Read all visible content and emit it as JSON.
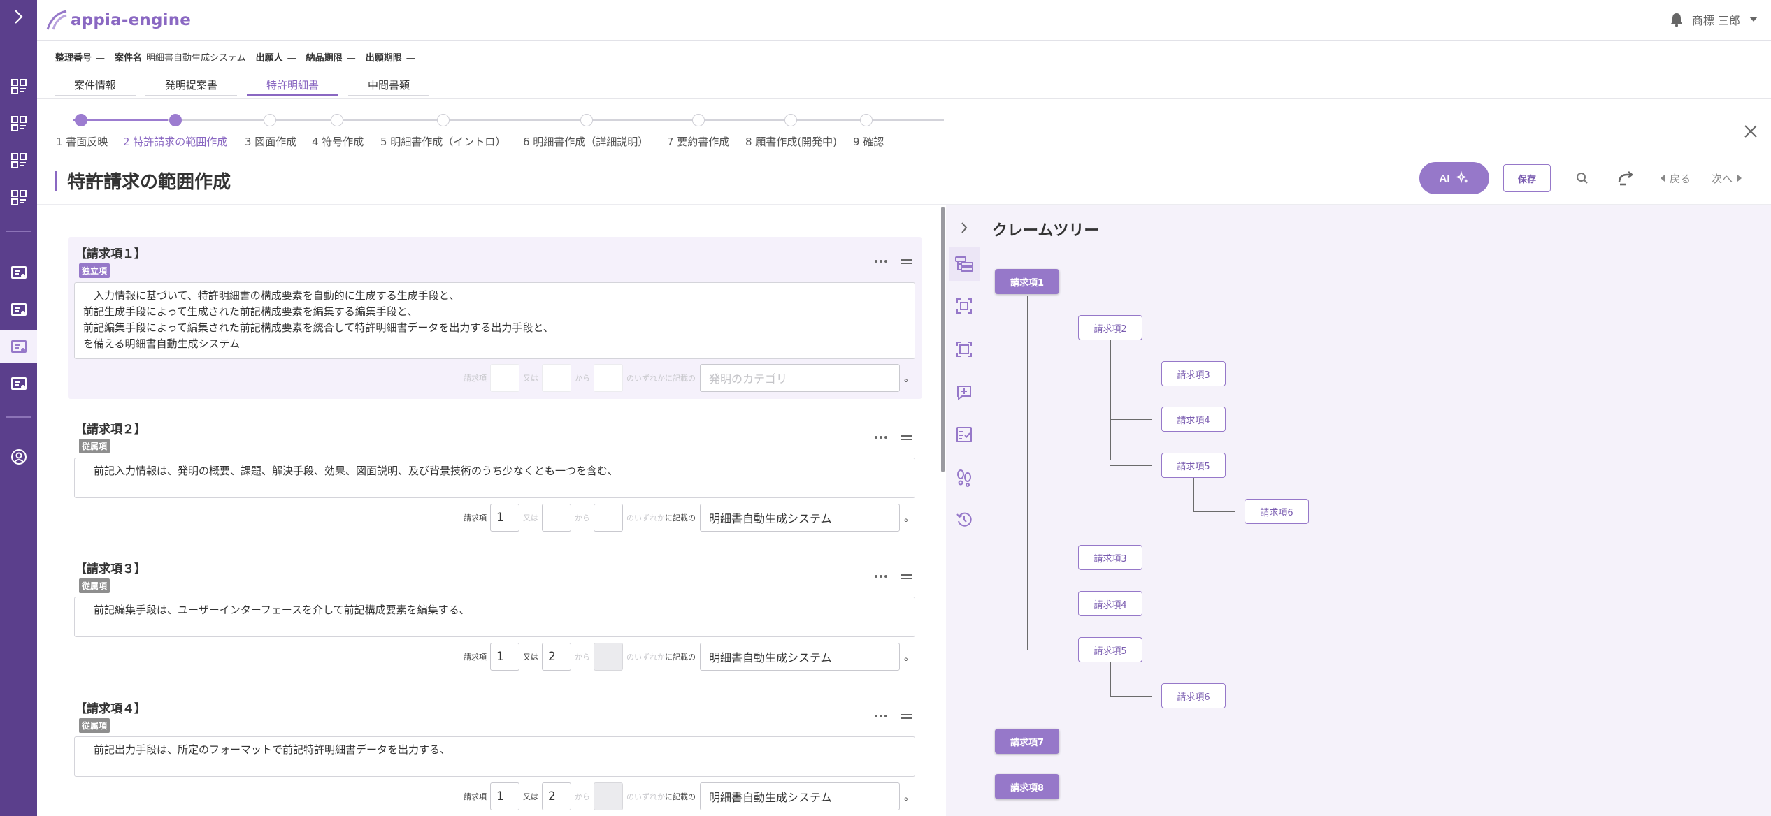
{
  "app": {
    "logo_text": "appia-engine",
    "user_name": "商標 三郎"
  },
  "case_info": [
    {
      "label": "整理番号",
      "value": "—"
    },
    {
      "label": "案件名",
      "value": "明細書自動生成システム"
    },
    {
      "label": "出願人",
      "value": "—"
    },
    {
      "label": "納品期限",
      "value": "—"
    },
    {
      "label": "出願期限",
      "value": "—"
    }
  ],
  "main_tabs": [
    {
      "label": "案件情報",
      "active": false
    },
    {
      "label": "発明提案書",
      "active": false
    },
    {
      "label": "特許明細書",
      "active": true
    },
    {
      "label": "中間書類",
      "active": false
    }
  ],
  "steps": [
    {
      "label": "1 書面反映",
      "state": "done"
    },
    {
      "label": "2 特許請求の範囲作成",
      "state": "active"
    },
    {
      "label": "3 図面作成",
      "state": "todo"
    },
    {
      "label": "4 符号作成",
      "state": "todo"
    },
    {
      "label": "5 明細書作成（イントロ）",
      "state": "todo"
    },
    {
      "label": "6 明細書作成（詳細説明）",
      "state": "todo"
    },
    {
      "label": "7 要約書作成",
      "state": "todo"
    },
    {
      "label": "8 願書作成(開発中)",
      "state": "todo"
    },
    {
      "label": "9 確認",
      "state": "todo"
    }
  ],
  "page": {
    "title": "特許請求の範囲作成"
  },
  "actions": {
    "ai_label": "AI",
    "save_label": "保存",
    "back_label": "戻る",
    "next_label": "次へ"
  },
  "ref_labels": {
    "claim_prefix": "請求項",
    "or": "又は",
    "from": "から",
    "any_of": "のいずれか",
    "described_in": "に記載の",
    "category_placeholder": "発明のカテゴリ",
    "period": "。"
  },
  "claims": [
    {
      "heading": "【請求項１】",
      "type": "独立項",
      "text": "　入力情報に基づいて、特許明細書の構成要素を自動的に生成する生成手段と、\n前記生成手段によって生成された前記構成要素を編集する編集手段と、\n前記編集手段によって編集された前記構成要素を統合して特許明細書データを出力する出力手段と、\nを備える明細書自動生成システム",
      "ref1": "",
      "ref2": "",
      "ref3": "",
      "category": ""
    },
    {
      "heading": "【請求項２】",
      "type": "従属項",
      "text": "　前記入力情報は、発明の概要、課題、解決手段、効果、図面説明、及び背景技術のうち少なくとも一つを含む、",
      "ref1": "1",
      "ref2": "",
      "ref3": "",
      "category": "明細書自動生成システム"
    },
    {
      "heading": "【請求項３】",
      "type": "従属項",
      "text": "　前記編集手段は、ユーザーインターフェースを介して前記構成要素を編集する、",
      "ref1": "1",
      "ref2": "2",
      "ref3": "",
      "category": "明細書自動生成システム"
    },
    {
      "heading": "【請求項４】",
      "type": "従属項",
      "text": "　前記出力手段は、所定のフォーマットで前記特許明細書データを出力する、",
      "ref1": "1",
      "ref2": "2",
      "ref3": "",
      "category": "明細書自動生成システム"
    }
  ],
  "claim_tree": {
    "title": "クレームツリー",
    "nodes": [
      "請求項1",
      "請求項2",
      "請求項3",
      "請求項4",
      "請求項5",
      "請求項6",
      "請求項3",
      "請求項4",
      "請求項5",
      "請求項6",
      "請求項7",
      "請求項8"
    ]
  },
  "colors": {
    "sidebar": "#5b3f8c",
    "accent": "#9678c9",
    "panel_bg": "#f5f2fa"
  }
}
